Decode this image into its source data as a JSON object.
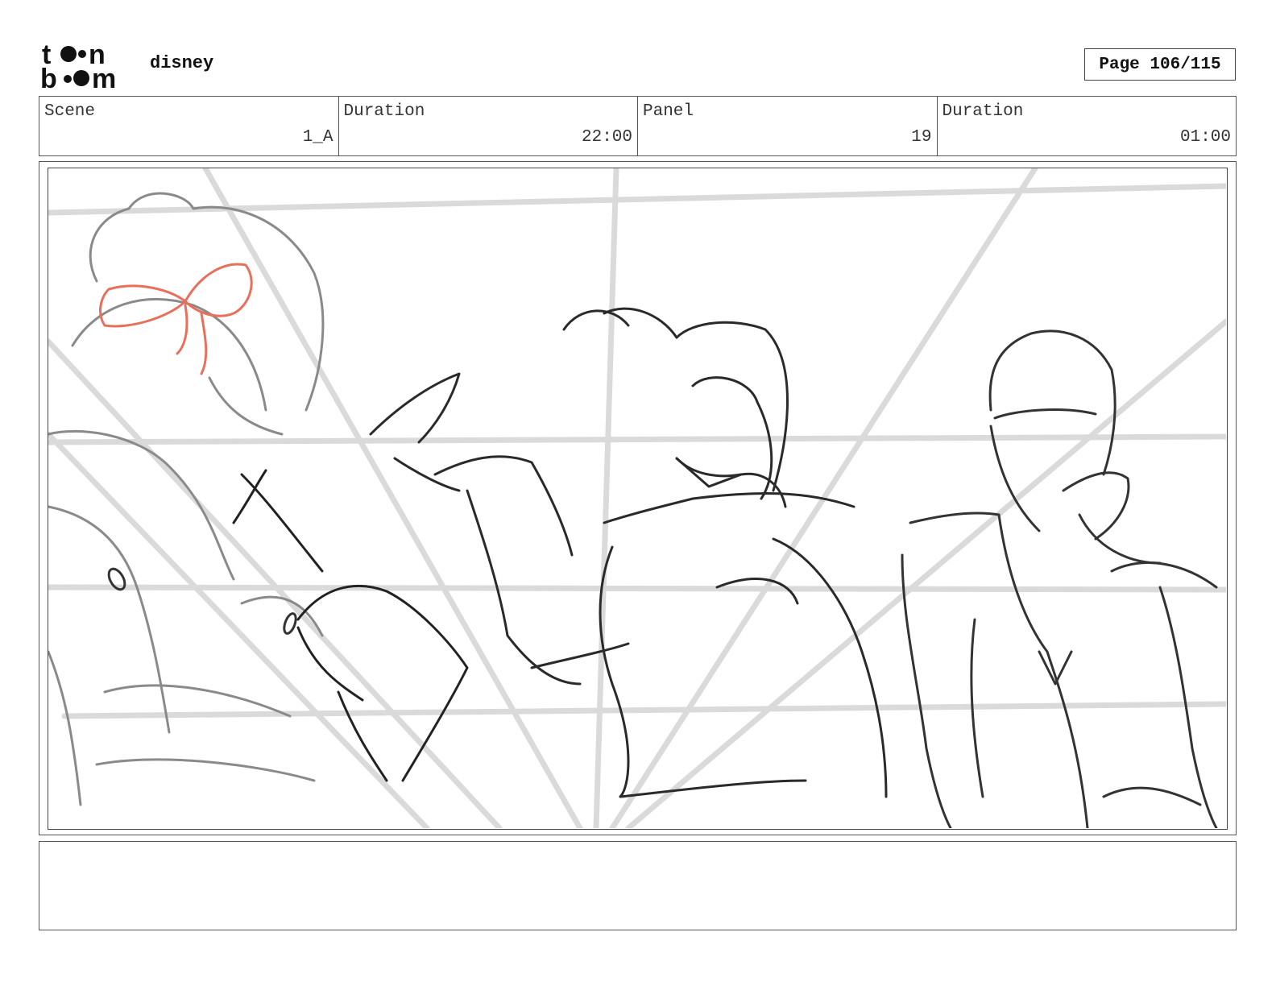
{
  "header": {
    "logo": {
      "name": "toon-boom-logo",
      "text": "toon boom"
    },
    "project_name": "disney",
    "page_label": "Page 106/115"
  },
  "info": {
    "scene_label": "Scene",
    "scene_value": "1_A",
    "scene_duration_label": "Duration",
    "scene_duration_value": "22:00",
    "panel_label": "Panel",
    "panel_value": "19",
    "panel_duration_label": "Duration",
    "panel_duration_value": "01:00"
  },
  "panel": {
    "image": "storyboard-sketch",
    "accent_color": "#e8705a",
    "notes": ""
  }
}
